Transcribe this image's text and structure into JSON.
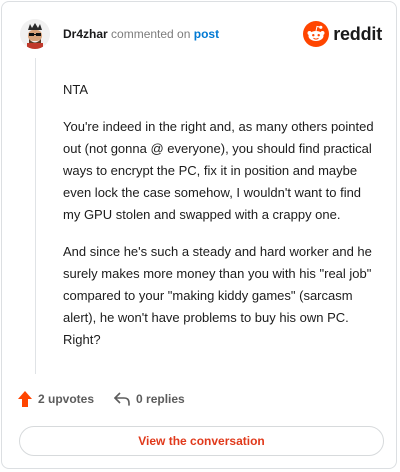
{
  "header": {
    "username": "Dr4zhar",
    "commented_on": "commented on",
    "post_link": "post",
    "logo_text": "reddit"
  },
  "comment": {
    "paragraphs": [
      "NTA",
      "You're indeed in the right and, as many others pointed out (not gonna @ everyone), you should find practical ways to encrypt the PC, fix it in position and maybe even lock the case somehow, I wouldn't want to find my GPU stolen and swapped with a crappy one.",
      "And since he's such a steady and hard worker and he surely makes more money than you with his \"real job\" compared to your \"making kiddy games\" (sarcasm alert), he won't have problems to buy his own PC. Right?"
    ]
  },
  "actions": {
    "upvotes": "2 upvotes",
    "replies": "0 replies"
  },
  "cta": {
    "label": "View the conversation"
  },
  "colors": {
    "brand_orange": "#ff4500",
    "link_blue": "#0079d3",
    "cta_text": "#e0391b"
  },
  "icons": [
    "avatar",
    "reddit-logo-icon",
    "upvote-icon",
    "reply-icon"
  ]
}
